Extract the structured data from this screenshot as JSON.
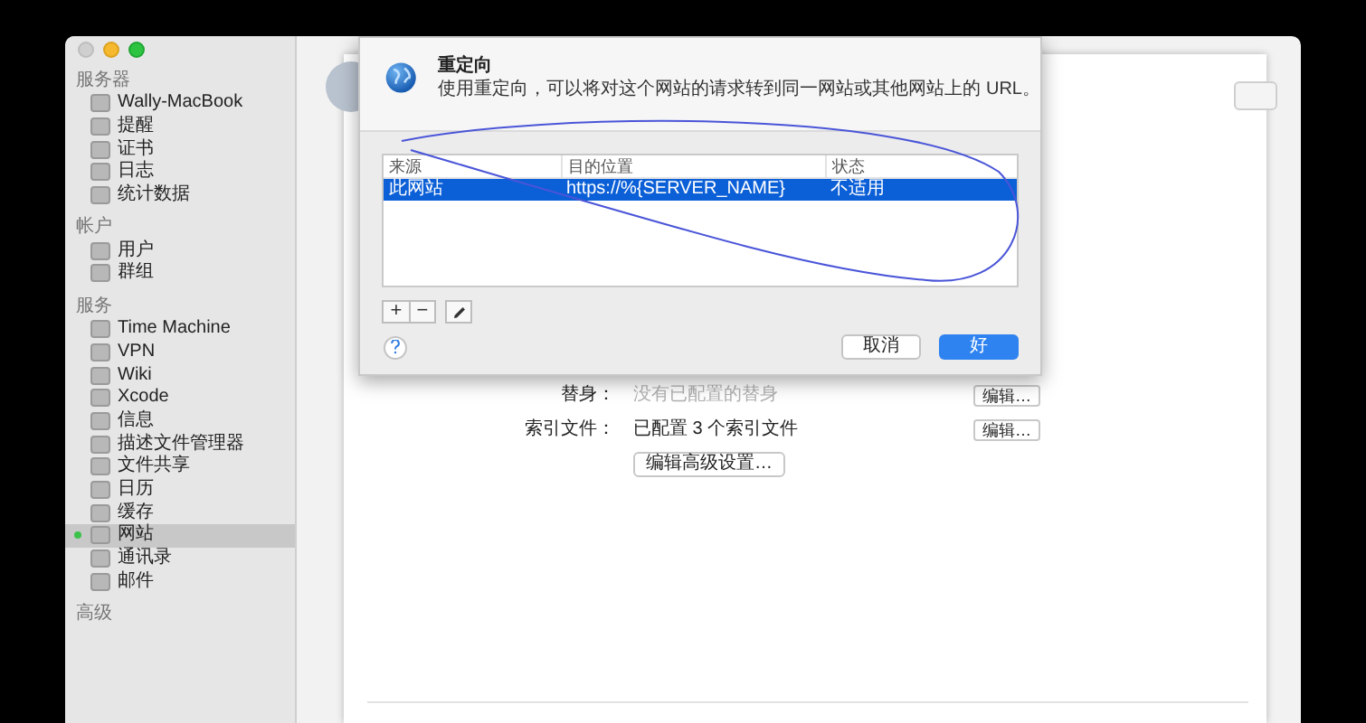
{
  "sidebar": {
    "sections": [
      {
        "title": "服务器",
        "items": [
          {
            "label": "Wally-MacBook",
            "selected": false,
            "running": false
          },
          {
            "label": "提醒",
            "selected": false,
            "running": false
          },
          {
            "label": "证书",
            "selected": false,
            "running": false
          },
          {
            "label": "日志",
            "selected": false,
            "running": false
          },
          {
            "label": "统计数据",
            "selected": false,
            "running": false
          }
        ]
      },
      {
        "title": "帐户",
        "items": [
          {
            "label": "用户",
            "selected": false,
            "running": false
          },
          {
            "label": "群组",
            "selected": false,
            "running": false
          }
        ]
      },
      {
        "title": "服务",
        "items": [
          {
            "label": "Time Machine",
            "selected": false,
            "running": false
          },
          {
            "label": "VPN",
            "selected": false,
            "running": false
          },
          {
            "label": "Wiki",
            "selected": false,
            "running": false
          },
          {
            "label": "Xcode",
            "selected": false,
            "running": false
          },
          {
            "label": "信息",
            "selected": false,
            "running": false
          },
          {
            "label": "描述文件管理器",
            "selected": false,
            "running": false
          },
          {
            "label": "文件共享",
            "selected": false,
            "running": false
          },
          {
            "label": "日历",
            "selected": false,
            "running": false
          },
          {
            "label": "缓存",
            "selected": false,
            "running": false
          },
          {
            "label": "网站",
            "selected": true,
            "running": true
          },
          {
            "label": "通讯录",
            "selected": false,
            "running": false
          },
          {
            "label": "邮件",
            "selected": false,
            "running": false
          }
        ]
      },
      {
        "title": "高级"
      }
    ]
  },
  "dialog": {
    "title": "重定向",
    "description": "使用重定向，可以将对这个网站的请求转到同一网站或其他网站上的 URL。",
    "table": {
      "columns": [
        "来源",
        "目的位置",
        "状态"
      ],
      "rows": [
        {
          "cells": [
            "此网站",
            "https://%{SERVER_NAME}",
            "不适用"
          ],
          "selected": true
        }
      ]
    },
    "tools": [
      "+",
      "−"
    ],
    "cancel_button": "取消",
    "ok_button": "好"
  },
  "settings": [
    {
      "label": "替身：",
      "value": "没有已配置的替身",
      "kind": "empty",
      "button": "编辑…"
    },
    {
      "label": "索引文件：",
      "value": "已配置 3 个索引文件",
      "kind": "set",
      "button": "编辑…"
    }
  ],
  "advanced_button": "编辑高级设置…"
}
